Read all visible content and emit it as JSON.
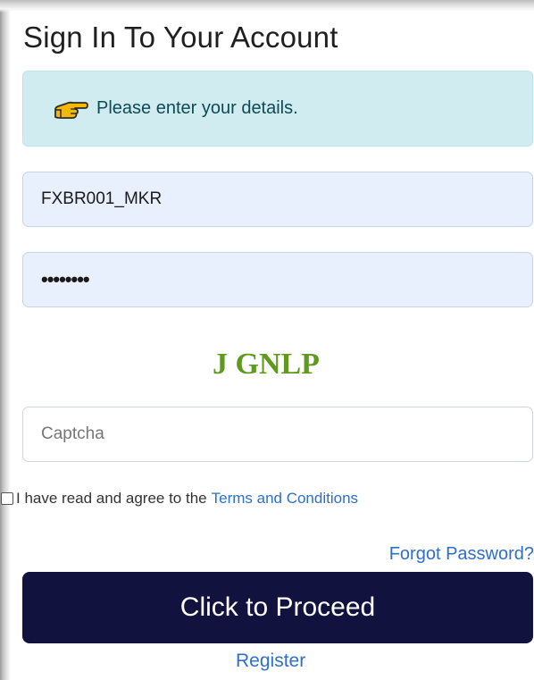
{
  "page": {
    "title": "Sign In To Your Account"
  },
  "alert": {
    "icon": "pointing-hand-icon",
    "message": "Please enter your details."
  },
  "form": {
    "username_value": "FXBR001_MKR",
    "password_value": "••••••••",
    "captcha_text": "J GNLP",
    "captcha_placeholder": "Captcha",
    "agree_text": "I have read and agree to the",
    "terms_link": "Terms and Conditions",
    "forgot_link": "Forgot Password?",
    "proceed_label": "Click to Proceed",
    "register_link": "Register"
  },
  "colors": {
    "alert_bg": "#d1ecf1",
    "autofill_bg": "#e8f0fe",
    "button_bg": "#12123f",
    "link": "#2d6fc9",
    "captcha_green": "#5f9a1e"
  }
}
